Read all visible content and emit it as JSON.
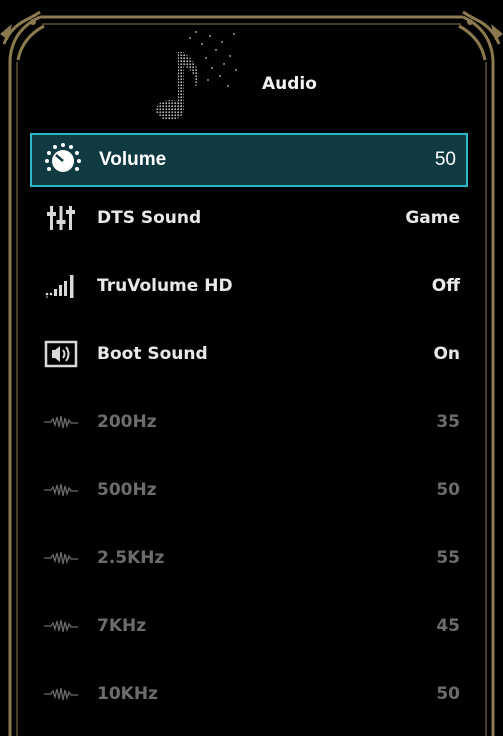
{
  "page": {
    "title": "Audio"
  },
  "colors": {
    "frame_gold": "#8a7a4e",
    "selected_bg": "#103a42",
    "selected_border": "#2bb9c9",
    "text": "#e8e8e8",
    "dim_text": "#6c6c6c"
  },
  "menu": {
    "items": [
      {
        "label": "Volume",
        "value": "50",
        "icon": "volume-dial-icon",
        "state": "selected"
      },
      {
        "label": "DTS Sound",
        "value": "Game",
        "icon": "equalizer-sliders-icon",
        "state": "normal"
      },
      {
        "label": "TruVolume HD",
        "value": "Off",
        "icon": "signal-bars-icon",
        "state": "normal"
      },
      {
        "label": "Boot Sound",
        "value": "On",
        "icon": "speaker-box-icon",
        "state": "normal"
      },
      {
        "label": "200Hz",
        "value": "35",
        "icon": "waveform-icon",
        "state": "disabled"
      },
      {
        "label": "500Hz",
        "value": "50",
        "icon": "waveform-icon",
        "state": "disabled"
      },
      {
        "label": "2.5KHz",
        "value": "55",
        "icon": "waveform-icon",
        "state": "disabled"
      },
      {
        "label": "7KHz",
        "value": "45",
        "icon": "waveform-icon",
        "state": "disabled"
      },
      {
        "label": "10KHz",
        "value": "50",
        "icon": "waveform-icon",
        "state": "disabled"
      }
    ]
  }
}
